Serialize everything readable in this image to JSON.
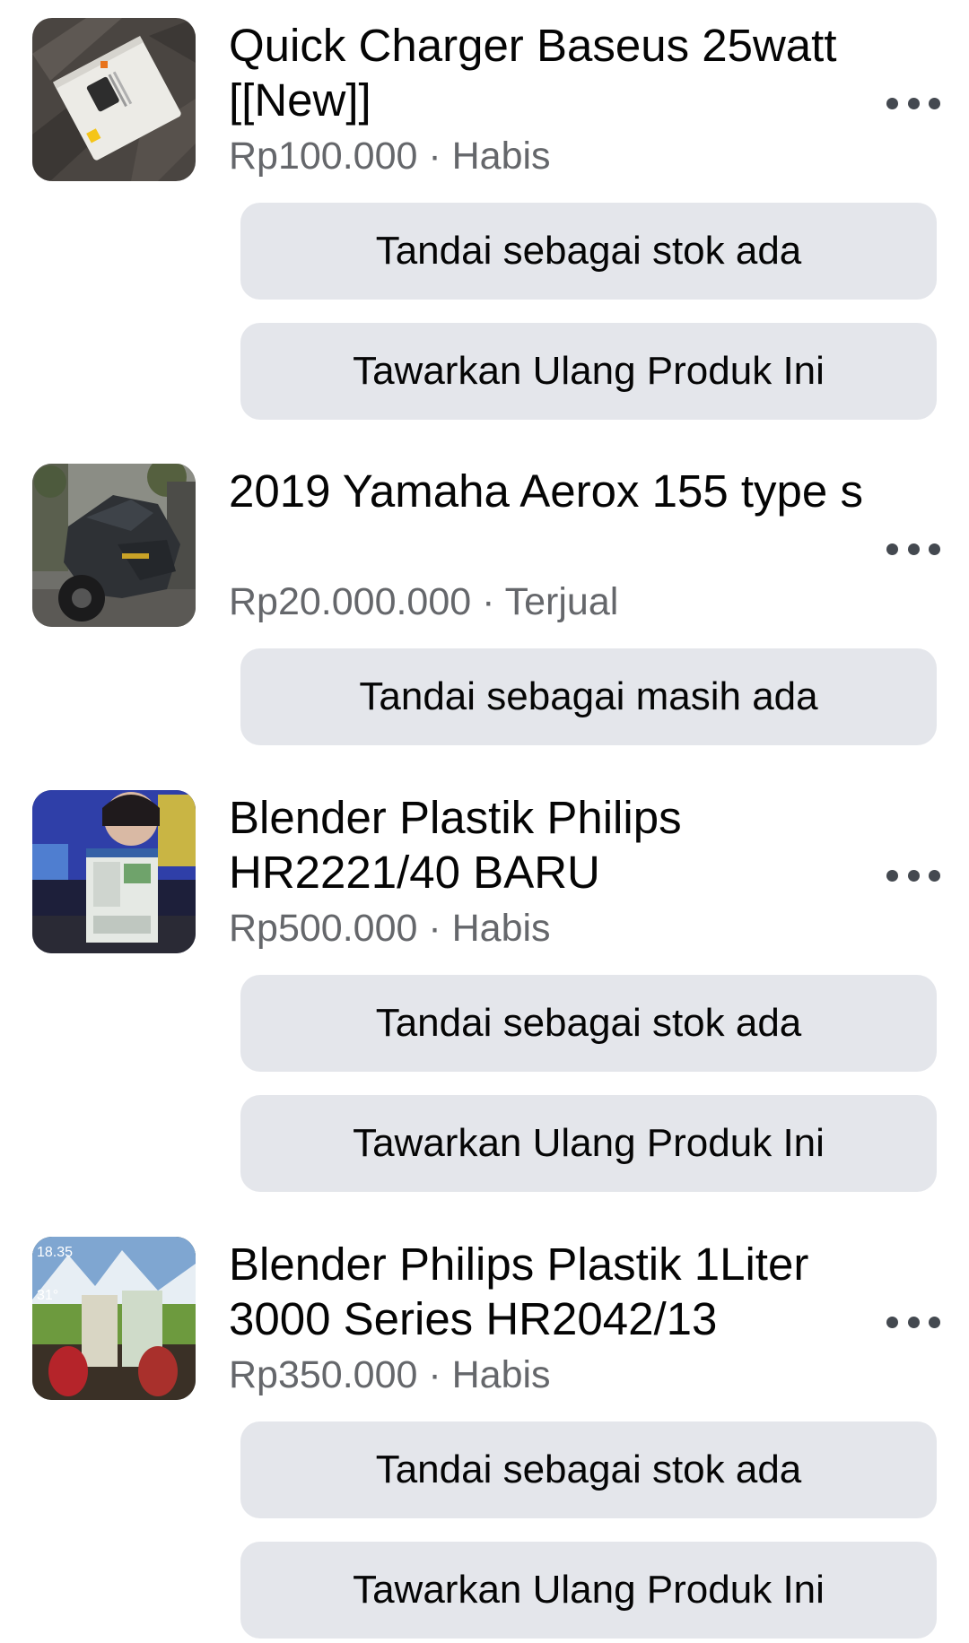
{
  "listings": [
    {
      "title": "Quick Charger Baseus 25watt [[New]]",
      "price": "Rp100.000",
      "separator": " · ",
      "status": "Habis",
      "buttons": [
        "Tandai sebagai stok ada",
        "Tawarkan Ulang Produk Ini"
      ],
      "thumbnail": "charger-box-photo"
    },
    {
      "title": "2019 Yamaha Aerox 155 type s",
      "price": "Rp20.000.000",
      "separator": " · ",
      "status": "Terjual",
      "buttons": [
        "Tandai sebagai masih ada"
      ],
      "thumbnail": "scooter-photo"
    },
    {
      "title": "Blender Plastik Philips HR2221/40 BARU",
      "price": "Rp500.000",
      "separator": " · ",
      "status": "Habis",
      "buttons": [
        "Tandai sebagai stok ada",
        "Tawarkan Ulang Produk Ini"
      ],
      "thumbnail": "blender-box-photo"
    },
    {
      "title": "Blender Philips Plastik 1Liter 3000 Series HR2042/13",
      "price": "Rp350.000",
      "separator": " · ",
      "status": "Habis",
      "buttons": [
        "Tandai sebagai stok ada",
        "Tawarkan Ulang Produk Ini"
      ],
      "thumbnail": "blender-display-photo",
      "thumbnail_overlay_text": [
        "18.35",
        "31°"
      ]
    }
  ],
  "colors": {
    "title": "#050505",
    "meta": "#65676b",
    "button_bg": "#e4e6eb",
    "more_icon": "#444950"
  },
  "icons": {
    "more": "more-options-icon"
  }
}
